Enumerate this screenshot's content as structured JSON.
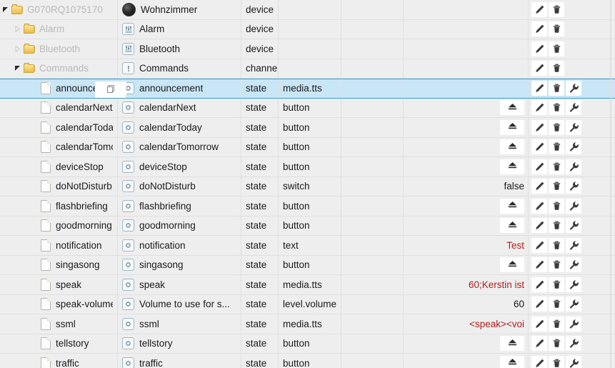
{
  "columns": {
    "tree": "tree",
    "name": "name",
    "type": "type",
    "role": "role",
    "blank": "",
    "value": "value",
    "actions": "actions"
  },
  "icons": {
    "folder": "folder-icon",
    "document": "document-icon",
    "expanded_triangle": "triangle-down-icon",
    "collapsed_triangle": "triangle-right-icon",
    "device_dot": "device-circle-icon",
    "sliders": "sliders-icon",
    "channel": "exclamation-icon",
    "state": "state-circle-icon",
    "copy": "copy-icon",
    "edit": "pencil-icon",
    "delete": "trash-icon",
    "settings": "wrench-icon",
    "button_action": "eject-button-icon"
  },
  "colors": {
    "selection_bg": "#c9e6f7",
    "selection_border": "#3a9bd1",
    "row_bg": "#eeeeee",
    "grid_line": "#e0e0e0",
    "value_red": "#b02020",
    "muted_text": "#b9b9b9"
  },
  "rows": [
    {
      "indent": 0,
      "twisty": "expanded",
      "treeicon": "folder",
      "tree": "G070RQ1075170",
      "tree_muted": true,
      "nameicon": "device_dot",
      "name": "Wohnzimmer",
      "type": "device",
      "role": "",
      "value": "",
      "value_kind": "none",
      "actions": [
        "edit",
        "delete"
      ],
      "selected": false
    },
    {
      "indent": 1,
      "twisty": "collapsed",
      "treeicon": "folder",
      "tree": "Alarm",
      "tree_muted": true,
      "nameicon": "sliders",
      "name": "Alarm",
      "type": "device",
      "role": "",
      "value": "",
      "value_kind": "none",
      "actions": [
        "edit",
        "delete"
      ],
      "selected": false
    },
    {
      "indent": 1,
      "twisty": "collapsed",
      "treeicon": "folder",
      "tree": "Bluetooth",
      "tree_muted": true,
      "nameicon": "sliders",
      "name": "Bluetooth",
      "type": "device",
      "role": "",
      "value": "",
      "value_kind": "none",
      "actions": [
        "edit",
        "delete"
      ],
      "selected": false
    },
    {
      "indent": 1,
      "twisty": "expanded",
      "treeicon": "folder",
      "tree": "Commands",
      "tree_muted": true,
      "nameicon": "channel",
      "name": "Commands",
      "type": "channel",
      "role": "",
      "value": "",
      "value_kind": "none",
      "actions": [
        "edit",
        "delete"
      ],
      "selected": false
    },
    {
      "indent": 2,
      "twisty": "none",
      "treeicon": "document",
      "tree": "announcement",
      "tree_muted": false,
      "copychip": true,
      "nameicon": "state",
      "name": "announcement",
      "type": "state",
      "role": "media.tts",
      "value": "",
      "value_kind": "none",
      "actions": [
        "edit",
        "delete",
        "settings"
      ],
      "selected": true
    },
    {
      "indent": 2,
      "twisty": "none",
      "treeicon": "document",
      "tree": "calendarNext",
      "tree_muted": false,
      "nameicon": "state",
      "name": "calendarNext",
      "type": "state",
      "role": "button",
      "value": "",
      "value_kind": "button",
      "actions": [
        "edit",
        "delete",
        "settings"
      ],
      "selected": false
    },
    {
      "indent": 2,
      "twisty": "none",
      "treeicon": "document",
      "tree": "calendarToday",
      "tree_muted": false,
      "nameicon": "state",
      "name": "calendarToday",
      "type": "state",
      "role": "button",
      "value": "",
      "value_kind": "button",
      "actions": [
        "edit",
        "delete",
        "settings"
      ],
      "selected": false
    },
    {
      "indent": 2,
      "twisty": "none",
      "treeicon": "document",
      "tree": "calendarTomorrow",
      "tree_muted": false,
      "nameicon": "state",
      "name": "calendarTomorrow",
      "type": "state",
      "role": "button",
      "value": "",
      "value_kind": "button",
      "actions": [
        "edit",
        "delete",
        "settings"
      ],
      "selected": false
    },
    {
      "indent": 2,
      "twisty": "none",
      "treeicon": "document",
      "tree": "deviceStop",
      "tree_muted": false,
      "nameicon": "state",
      "name": "deviceStop",
      "type": "state",
      "role": "button",
      "value": "",
      "value_kind": "button",
      "actions": [
        "edit",
        "delete",
        "settings"
      ],
      "selected": false
    },
    {
      "indent": 2,
      "twisty": "none",
      "treeicon": "document",
      "tree": "doNotDisturb",
      "tree_muted": false,
      "nameicon": "state",
      "name": "doNotDisturb",
      "type": "state",
      "role": "switch",
      "value": "false",
      "value_kind": "text",
      "actions": [
        "edit",
        "delete",
        "settings"
      ],
      "selected": false
    },
    {
      "indent": 2,
      "twisty": "none",
      "treeicon": "document",
      "tree": "flashbriefing",
      "tree_muted": false,
      "nameicon": "state",
      "name": "flashbriefing",
      "type": "state",
      "role": "button",
      "value": "",
      "value_kind": "button",
      "actions": [
        "edit",
        "delete",
        "settings"
      ],
      "selected": false
    },
    {
      "indent": 2,
      "twisty": "none",
      "treeicon": "document",
      "tree": "goodmorning",
      "tree_muted": false,
      "nameicon": "state",
      "name": "goodmorning",
      "type": "state",
      "role": "button",
      "value": "",
      "value_kind": "button",
      "actions": [
        "edit",
        "delete",
        "settings"
      ],
      "selected": false
    },
    {
      "indent": 2,
      "twisty": "none",
      "treeicon": "document",
      "tree": "notification",
      "tree_muted": false,
      "nameicon": "state",
      "name": "notification",
      "type": "state",
      "role": "text",
      "value": "Test",
      "value_kind": "red",
      "actions": [
        "edit",
        "delete",
        "settings"
      ],
      "selected": false
    },
    {
      "indent": 2,
      "twisty": "none",
      "treeicon": "document",
      "tree": "singasong",
      "tree_muted": false,
      "nameicon": "state",
      "name": "singasong",
      "type": "state",
      "role": "button",
      "value": "",
      "value_kind": "button",
      "actions": [
        "edit",
        "delete",
        "settings"
      ],
      "selected": false
    },
    {
      "indent": 2,
      "twisty": "none",
      "treeicon": "document",
      "tree": "speak",
      "tree_muted": false,
      "nameicon": "state",
      "name": "speak",
      "type": "state",
      "role": "media.tts",
      "value": "60;Kerstin ist",
      "value_kind": "red",
      "actions": [
        "edit",
        "delete",
        "settings"
      ],
      "selected": false
    },
    {
      "indent": 2,
      "twisty": "none",
      "treeicon": "document",
      "tree": "speak-volume",
      "tree_muted": false,
      "nameicon": "state",
      "name": "Volume to use for s...",
      "type": "state",
      "role": "level.volume",
      "value": "60",
      "value_kind": "text",
      "actions": [
        "edit",
        "delete",
        "settings"
      ],
      "selected": false
    },
    {
      "indent": 2,
      "twisty": "none",
      "treeicon": "document",
      "tree": "ssml",
      "tree_muted": false,
      "nameicon": "state",
      "name": "ssml",
      "type": "state",
      "role": "media.tts",
      "value": "<speak><voi",
      "value_kind": "red",
      "actions": [
        "edit",
        "delete",
        "settings"
      ],
      "selected": false
    },
    {
      "indent": 2,
      "twisty": "none",
      "treeicon": "document",
      "tree": "tellstory",
      "tree_muted": false,
      "nameicon": "state",
      "name": "tellstory",
      "type": "state",
      "role": "button",
      "value": "",
      "value_kind": "button",
      "actions": [
        "edit",
        "delete",
        "settings"
      ],
      "selected": false
    },
    {
      "indent": 2,
      "twisty": "none",
      "treeicon": "document",
      "tree": "traffic",
      "tree_muted": false,
      "nameicon": "state",
      "name": "traffic",
      "type": "state",
      "role": "button",
      "value": "",
      "value_kind": "button",
      "actions": [
        "edit",
        "delete",
        "settings"
      ],
      "selected": false
    }
  ]
}
